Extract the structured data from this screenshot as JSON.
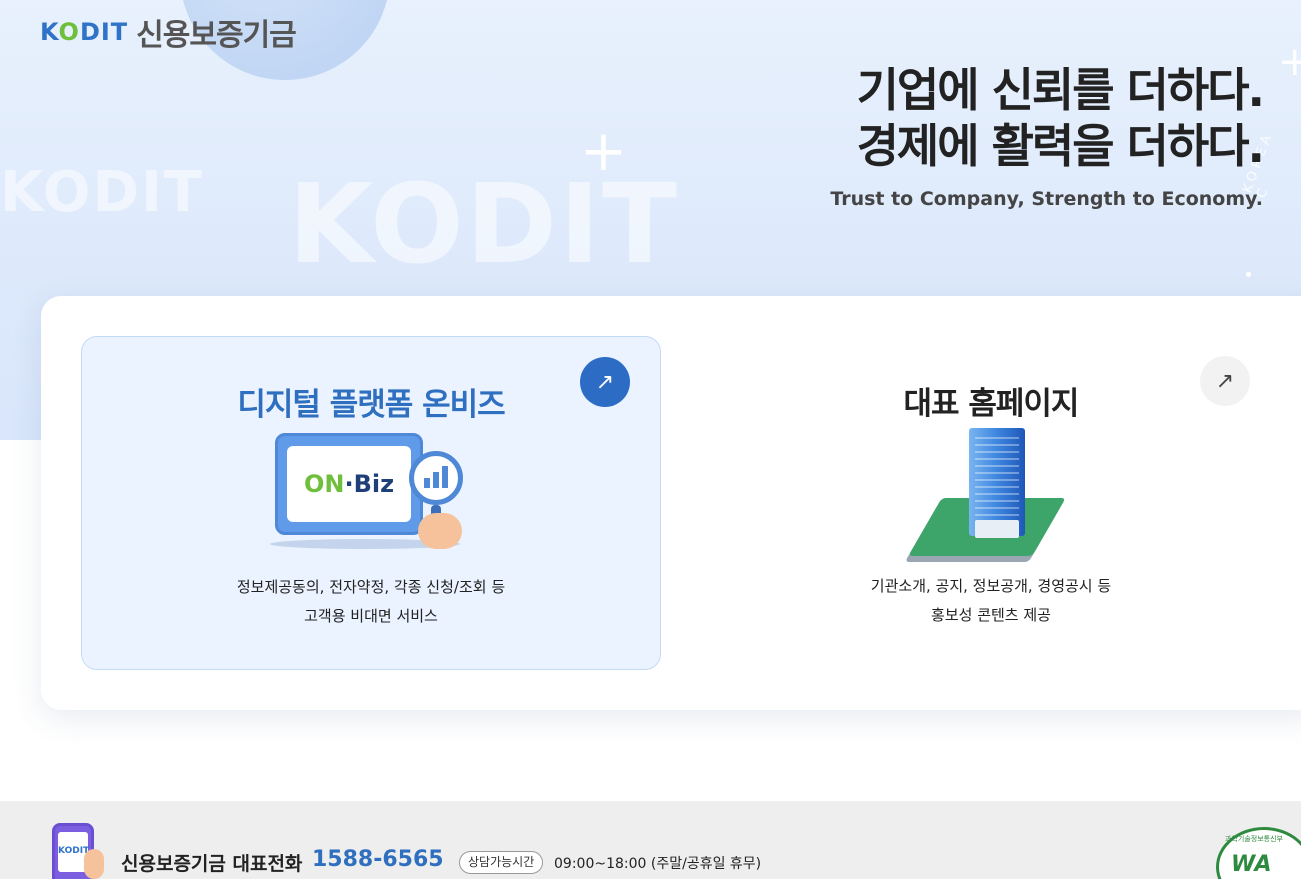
{
  "header": {
    "logo_mark_k": "K",
    "logo_mark_o": "O",
    "logo_mark_dit": "DIT",
    "logo_name": "신용보증기금"
  },
  "hero": {
    "slogan_line1": "기업에 신뢰를 더하다.",
    "slogan_line2": "경제에 활력을 더하다.",
    "slogan_en": "Trust to Company, Strength to Economy.",
    "watermark_big": "KODIT",
    "watermark_small": "KODIT",
    "vertical_text": "KOREA C"
  },
  "cards": {
    "onbiz": {
      "title": "디지털 플랫폼 온비즈",
      "arrow": "↗",
      "logo_on": "ON",
      "logo_dot": "·",
      "logo_biz": "Biz",
      "desc_line1": "정보제공동의, 전자약정, 각종 신청/조회 등",
      "desc_line2": "고객용 비대면 서비스"
    },
    "home": {
      "title": "대표 홈페이지",
      "arrow": "↗",
      "desc_line1": "기관소개, 공지, 정보공개, 경영공시 등",
      "desc_line2": "홍보성 콘텐츠 제공"
    }
  },
  "footer": {
    "phone_screen_text": "KODIT",
    "label": "신용보증기금 대표전화",
    "number": "1588-6565",
    "hours_pill": "상담가능시간",
    "hours": "09:00~18:00 (주말/공휴일 휴무)",
    "badge_text": "WA",
    "badge_arc_text": "과학기술정보통신부"
  },
  "colors": {
    "accent_blue": "#2f6fbf",
    "brand_green": "#6fbf3c",
    "hero_bg": "#e1ecfc",
    "footer_bg": "#eeeeee"
  },
  "icons": {
    "onbiz_arrow": "arrow-up-right-icon",
    "home_arrow": "arrow-up-right-icon",
    "sparkle": "sparkle-icon",
    "phone": "phone-icon",
    "wa_badge": "wa-certification-icon"
  }
}
